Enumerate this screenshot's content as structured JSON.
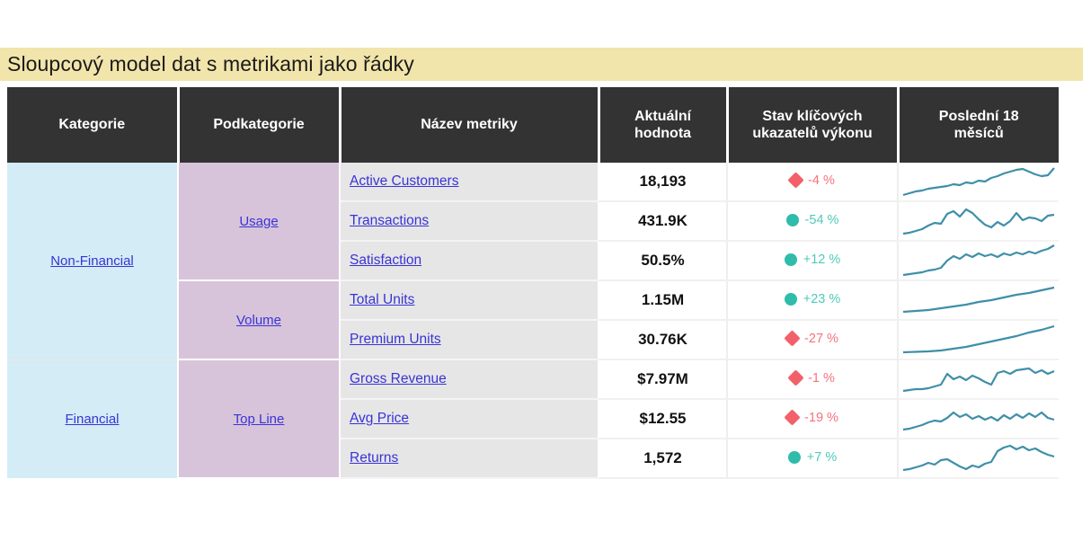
{
  "title": "Sloupcový model dat s metrikami jako řádky",
  "colors": {
    "title_band": "#f2e5ab",
    "header_bg": "#333333",
    "category_bg": "#d3ecf6",
    "subcategory_bg": "#d8c4da",
    "metric_bg": "#e6e6e6",
    "link": "#3a33d6",
    "kpi_bad": "#f2606a",
    "kpi_good": "#2fbcab",
    "sparkline": "#3f8fa8"
  },
  "table": {
    "headers": [
      {
        "label": "Kategorie",
        "name": "header-kategorie"
      },
      {
        "label": "Podkategorie",
        "name": "header-podkategorie"
      },
      {
        "label": "Název metriky",
        "name": "header-nazev-metriky"
      },
      {
        "label": "Aktuální hodnota",
        "line1": "Aktuální",
        "line2": "hodnota",
        "name": "header-aktualni-hodnota"
      },
      {
        "label": "Stav klíčových ukazatelů výkonu",
        "line1": "Stav klíčových",
        "line2": "ukazatelů výkonu",
        "name": "header-stav-kpi"
      },
      {
        "label": "Poslední 18 měsíců",
        "line1": "Poslední 18",
        "line2": "měsíců",
        "name": "header-poslednich-18-mesicu"
      }
    ],
    "categories": [
      {
        "label": "Non-Financial",
        "rows": 5
      },
      {
        "label": "Financial",
        "rows": 3
      }
    ],
    "subcategories": [
      {
        "label": "Usage",
        "rows": 3
      },
      {
        "label": "Volume",
        "rows": 2
      },
      {
        "label": "Top Line",
        "rows": 3
      }
    ],
    "rows": [
      {
        "metric": "Active Customers",
        "value": "18,193",
        "kpi": "-4 %",
        "kpi_shape": "diamond",
        "kpi_state": "bad",
        "spark": "noisy-rise"
      },
      {
        "metric": "Transactions",
        "value": "431.9K",
        "kpi": "-54 %",
        "kpi_shape": "circle",
        "kpi_state": "good",
        "spark": "noisy-wave"
      },
      {
        "metric": "Satisfaction",
        "value": "50.5%",
        "kpi": "+12 %",
        "kpi_shape": "circle",
        "kpi_state": "good",
        "spark": "noisy-rise2"
      },
      {
        "metric": "Total Units",
        "value": "1.15M",
        "kpi": "+23 %",
        "kpi_shape": "circle",
        "kpi_state": "good",
        "spark": "smooth-rise"
      },
      {
        "metric": "Premium Units",
        "value": "30.76K",
        "kpi": "-27 %",
        "kpi_shape": "diamond",
        "kpi_state": "bad",
        "spark": "smooth-rise2"
      },
      {
        "metric": "Gross Revenue",
        "value": "$7.97M",
        "kpi": "-1 %",
        "kpi_shape": "diamond",
        "kpi_state": "bad",
        "spark": "noisy-rise3"
      },
      {
        "metric": "Avg Price",
        "value": "$12.55",
        "kpi": "-19 %",
        "kpi_shape": "diamond",
        "kpi_state": "bad",
        "spark": "noisy-step"
      },
      {
        "metric": "Returns",
        "value": "1,572",
        "kpi": "+7 %",
        "kpi_shape": "circle",
        "kpi_state": "good",
        "spark": "noisy-hump"
      }
    ]
  },
  "chart_data": {
    "type": "line",
    "title": "Poslední 18 měsíců — sparklines",
    "xlabel": "",
    "ylabel": "",
    "series": [
      {
        "name": "Active Customers",
        "values": [
          3,
          5,
          7,
          9,
          12,
          14,
          18,
          22,
          21,
          26,
          30,
          33,
          38,
          46,
          52,
          50,
          45,
          58
        ]
      },
      {
        "name": "Transactions",
        "values": [
          4,
          6,
          9,
          13,
          20,
          26,
          25,
          38,
          44,
          35,
          30,
          26,
          32,
          28,
          40,
          31,
          36,
          34
        ]
      },
      {
        "name": "Satisfaction",
        "values": [
          2,
          4,
          6,
          8,
          11,
          14,
          24,
          28,
          26,
          30,
          34,
          33,
          38,
          36,
          40,
          44,
          48,
          58
        ]
      },
      {
        "name": "Total Units",
        "values": [
          5,
          7,
          9,
          12,
          15,
          19,
          23,
          27,
          31,
          35,
          39,
          43,
          47,
          51,
          55,
          58,
          62,
          66
        ]
      },
      {
        "name": "Premium Units",
        "values": [
          4,
          5,
          6,
          8,
          10,
          13,
          16,
          20,
          24,
          29,
          34,
          39,
          44,
          49,
          54,
          59,
          64,
          69
        ]
      },
      {
        "name": "Gross Revenue",
        "values": [
          6,
          8,
          10,
          13,
          16,
          20,
          34,
          28,
          30,
          33,
          26,
          18,
          38,
          42,
          40,
          48,
          44,
          46
        ]
      },
      {
        "name": "Avg Price",
        "values": [
          5,
          9,
          14,
          20,
          24,
          28,
          26,
          18,
          14,
          20,
          22,
          26,
          44,
          52,
          56,
          50,
          54,
          40
        ]
      },
      {
        "name": "Returns",
        "values": [
          4,
          6,
          9,
          12,
          16,
          22,
          20,
          28,
          34,
          30,
          36,
          44,
          52,
          48,
          40,
          50,
          46,
          44
        ]
      }
    ]
  }
}
